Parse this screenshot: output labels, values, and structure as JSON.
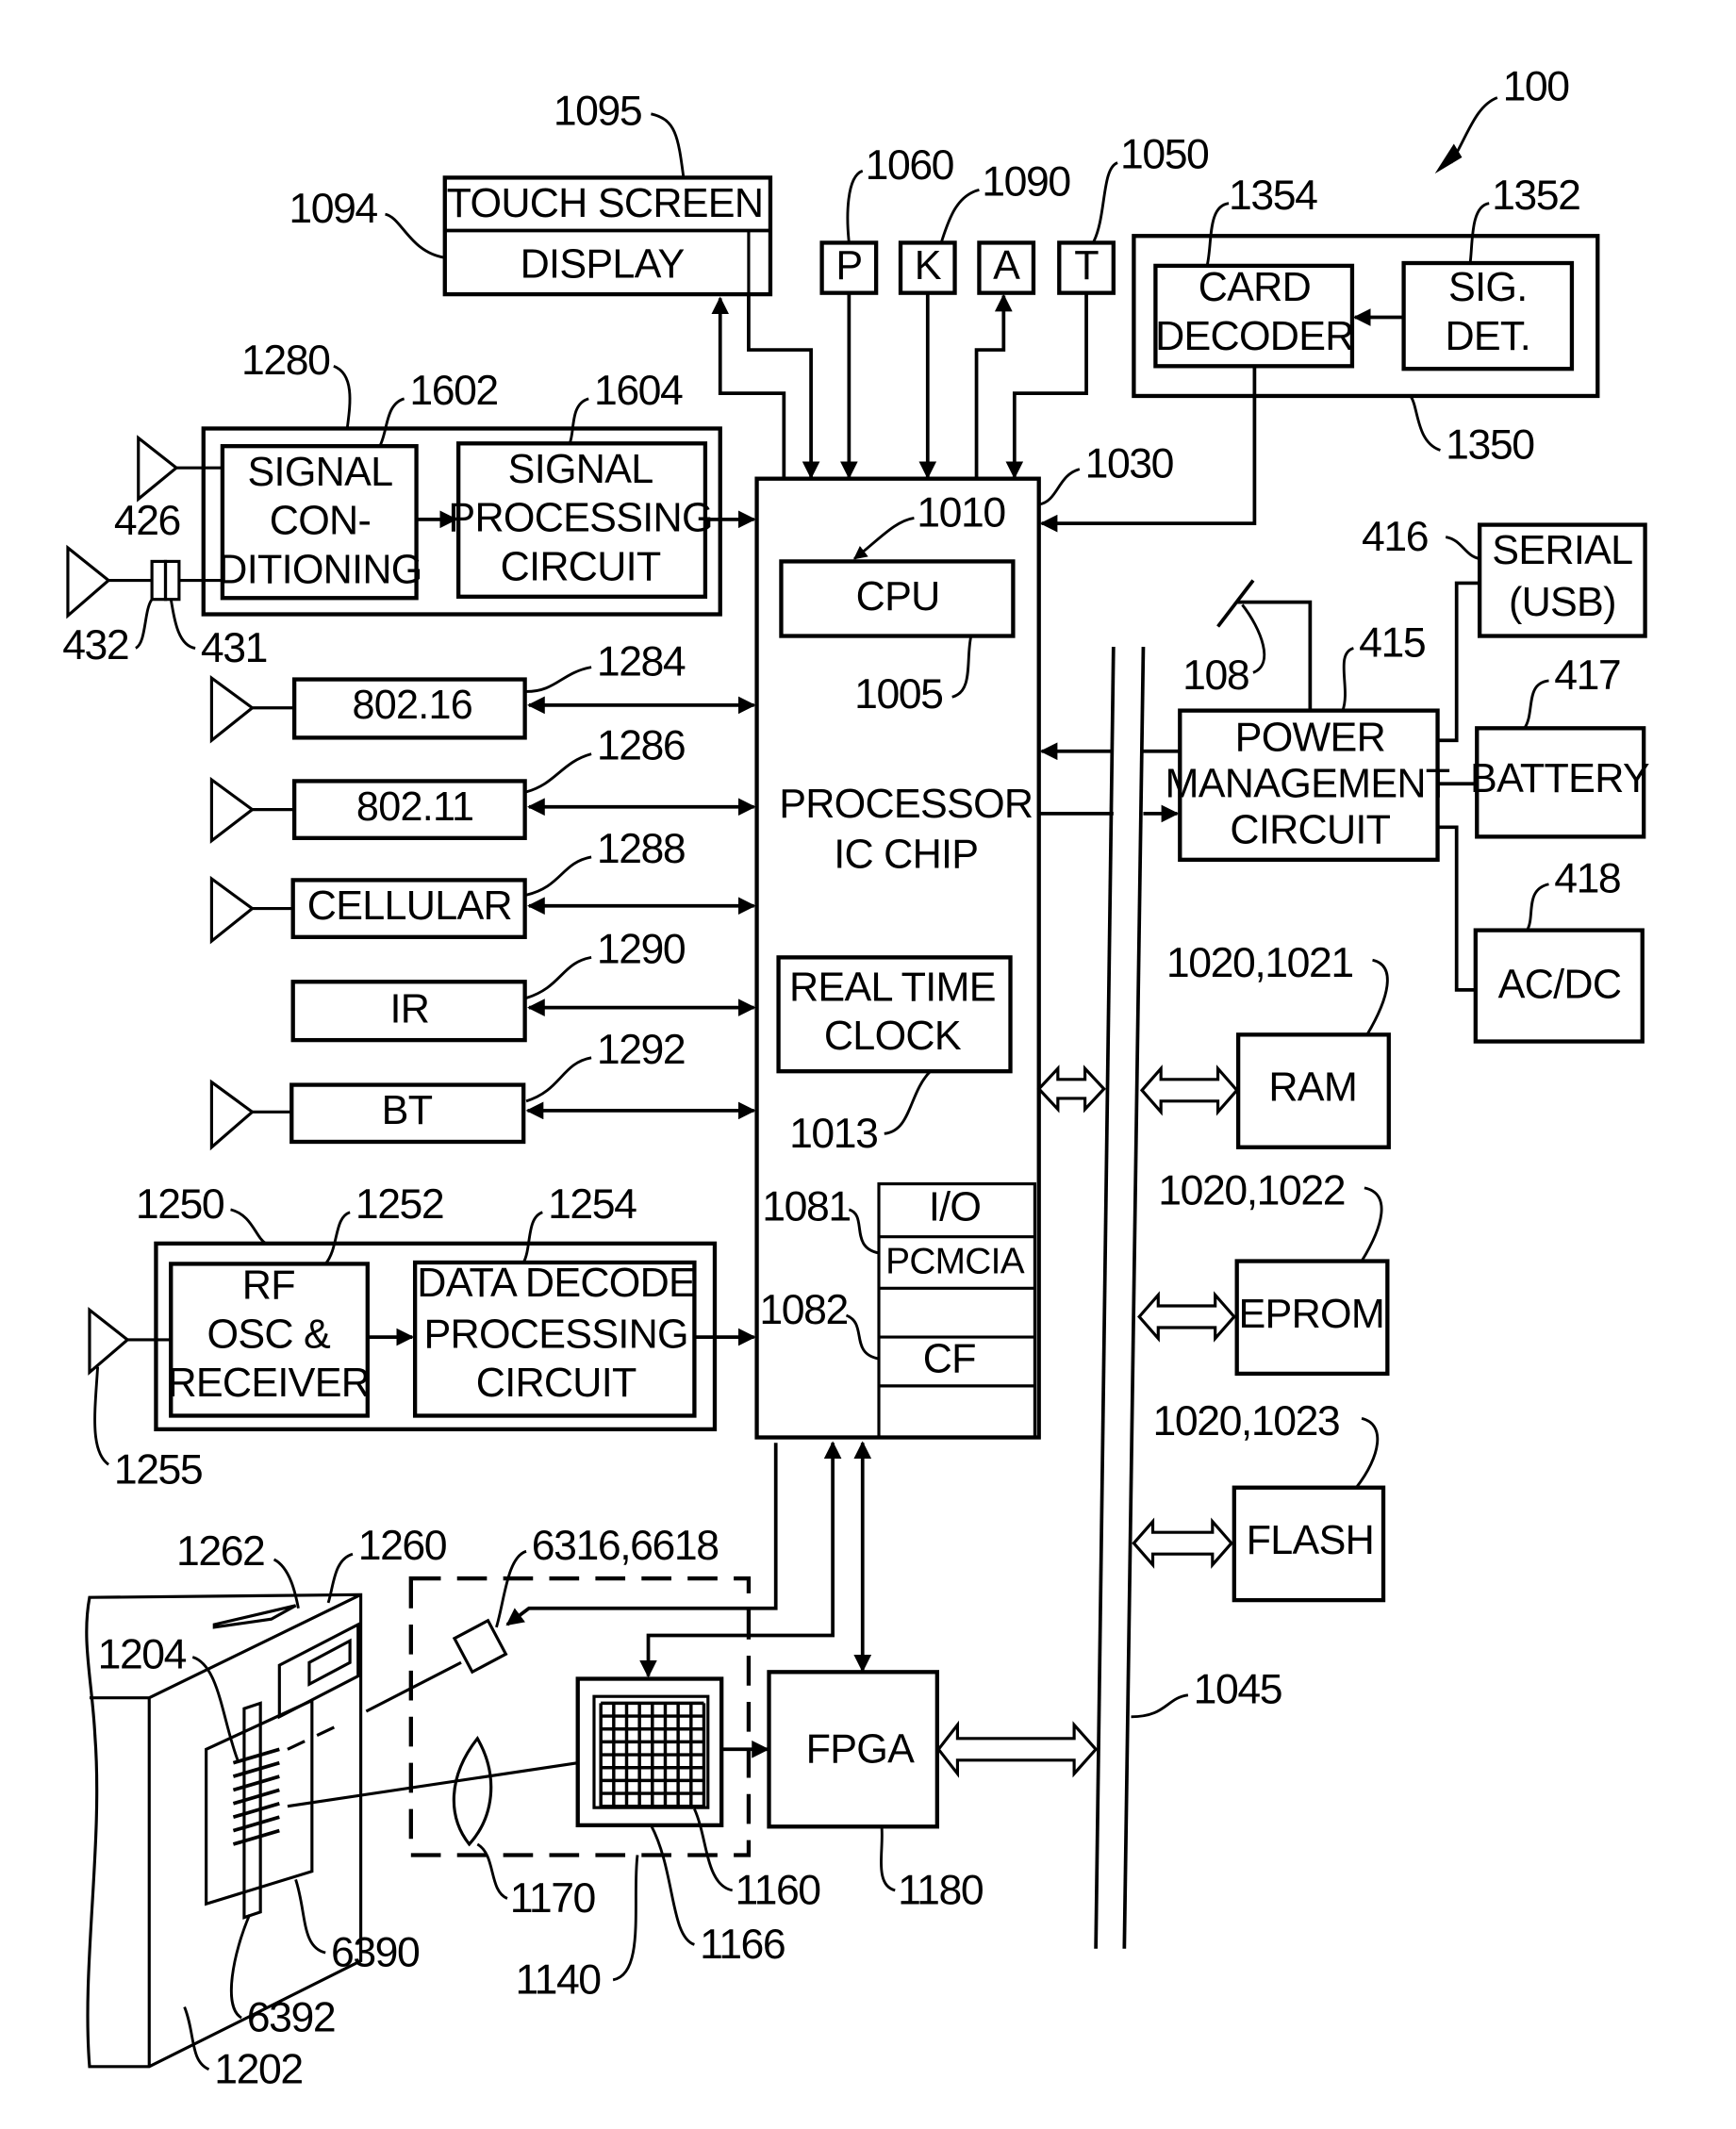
{
  "figure": {
    "reference": "100",
    "colors": {
      "ink": "#000000",
      "paper": "#ffffff"
    }
  },
  "blocks": {
    "touch_screen": "TOUCH SCREEN",
    "display": "DISPLAY",
    "p": "P",
    "k": "K",
    "a": "A",
    "t": "T",
    "card_decoder": [
      "CARD",
      "DECODER"
    ],
    "sig_det": [
      "SIG.",
      "DET."
    ],
    "signal_conditioning": [
      "SIGNAL",
      "CON-",
      "DITIONING"
    ],
    "signal_processing": [
      "SIGNAL",
      "PROCESSING",
      "CIRCUIT"
    ],
    "cpu": "CPU",
    "processor": [
      "PROCESSOR",
      "IC CHIP"
    ],
    "rtc": [
      "REAL TIME",
      "CLOCK"
    ],
    "io": "I/O",
    "pcmcia": "PCMCIA",
    "cf": "CF",
    "radio_80216": "802.16",
    "radio_80211": "802.11",
    "cellular": "CELLULAR",
    "ir": "IR",
    "bt": "BT",
    "rf_osc": [
      "RF",
      "OSC &",
      "RECEIVER"
    ],
    "data_decode": [
      "DATA DECODE",
      "PROCESSING",
      "CIRCUIT"
    ],
    "power_mgmt": [
      "POWER",
      "MANAGEMENT",
      "CIRCUIT"
    ],
    "serial": [
      "SERIAL",
      "(USB)"
    ],
    "battery": "BATTERY",
    "acdc": "AC/DC",
    "ram": "RAM",
    "eprom": "EPROM",
    "flash": "FLASH",
    "fpga": "FPGA"
  },
  "refs": {
    "r100": "100",
    "r1095": "1095",
    "r1094": "1094",
    "r1060": "1060",
    "r1090": "1090",
    "r1050": "1050",
    "r1354": "1354",
    "r1352": "1352",
    "r1350": "1350",
    "r1280": "1280",
    "r1602": "1602",
    "r1604": "1604",
    "r1030": "1030",
    "r1010": "1010",
    "r1005": "1005",
    "r426": "426",
    "r432": "432",
    "r431": "431",
    "r416": "416",
    "r415": "415",
    "r108": "108",
    "r417": "417",
    "r418": "418",
    "r1284": "1284",
    "r1286": "1286",
    "r1288": "1288",
    "r1290": "1290",
    "r1292": "1292",
    "r1013": "1013",
    "r1021": "1020,1021",
    "r1022": "1020,1022",
    "r1023": "1020,1023",
    "r1081": "1081",
    "r1082": "1082",
    "r1250": "1250",
    "r1252": "1252",
    "r1254": "1254",
    "r1255": "1255",
    "r1262": "1262",
    "r1260": "1260",
    "r6316": "6316,6618",
    "r1204": "1204",
    "r1045": "1045",
    "r1170": "1170",
    "r1160": "1160",
    "r1180": "1180",
    "r1166": "1166",
    "r1140": "1140",
    "r6390": "6390",
    "r6392": "6392",
    "r1202": "1202"
  }
}
